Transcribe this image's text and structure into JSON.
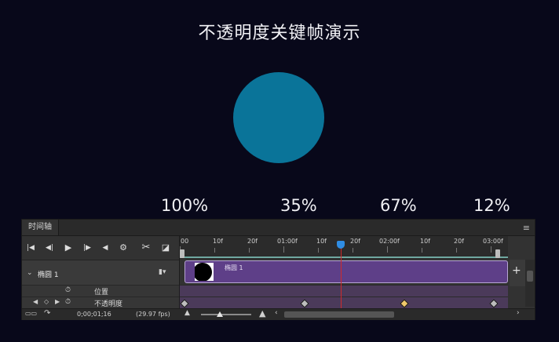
{
  "title": "不透明度关键帧演示",
  "colors": {
    "background": "#08081a",
    "circle": "#0a7499",
    "clip": "#5e3f88",
    "playhead": "#d12a2a",
    "keyframe_selected": "#f0c96b"
  },
  "opacity_labels": [
    "100%",
    "35%",
    "67%",
    "12%"
  ],
  "timeline": {
    "panel_title": "时间轴",
    "menu_icon": "≡",
    "ruler_labels": [
      "00",
      "10f",
      "20f",
      "01:00f",
      "10f",
      "20f",
      "02:00f",
      "10f",
      "20f",
      "03:00f"
    ],
    "layer_name": "椭圆 1",
    "clip_name": "椭圆 1",
    "properties": [
      "位置",
      "不透明度"
    ],
    "timecode": "0;00;01;16",
    "fps": "(29.97 fps)",
    "add_label": "+"
  },
  "icons": {
    "first_frame": "go-to-first-frame-icon",
    "prev_frame": "previous-frame-icon",
    "play": "play-icon",
    "next_frame": "next-frame-icon",
    "audio": "audio-icon",
    "settings": "settings-icon",
    "scissors": "split-scissors-icon",
    "transition": "transition-icon"
  }
}
